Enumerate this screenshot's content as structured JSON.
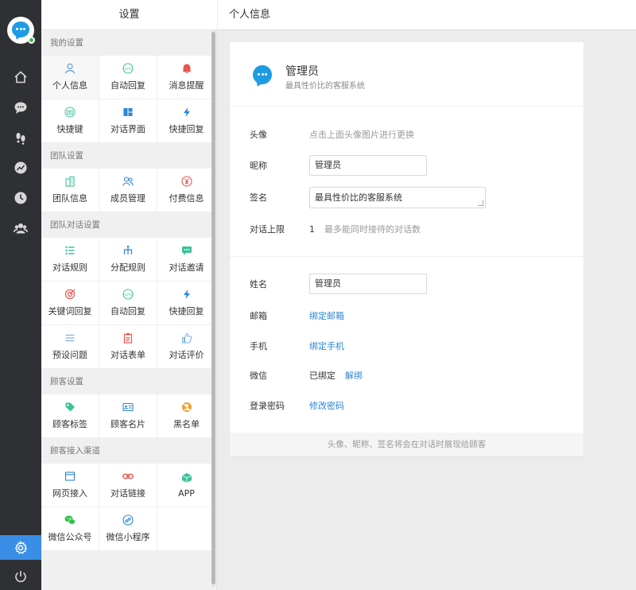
{
  "rail": {
    "icons": [
      "home-icon",
      "chat-icon",
      "footprint-icon",
      "chart-icon",
      "clock-icon",
      "team-icon",
      "settings-icon",
      "power-icon"
    ],
    "accent": "#3a8ee6",
    "bg": "#2f3033"
  },
  "settings": {
    "title": "设置",
    "groups": [
      {
        "title": "我的设置",
        "items": [
          {
            "label": "个人信息",
            "icon": "user-icon",
            "color": "#5b9bd5"
          },
          {
            "label": "自动回复",
            "icon": "auto-icon",
            "color": "#3cc29b"
          },
          {
            "label": "消息提醒",
            "icon": "bell-icon",
            "color": "#e8554e"
          },
          {
            "label": "快捷键",
            "icon": "keyboard-icon",
            "color": "#3cc29b"
          },
          {
            "label": "对话界面",
            "icon": "layout-icon",
            "color": "#2a86d9"
          },
          {
            "label": "快捷回复",
            "icon": "bolt-icon",
            "color": "#2a86d9"
          }
        ]
      },
      {
        "title": "团队设置",
        "items": [
          {
            "label": "团队信息",
            "icon": "building-icon",
            "color": "#3cc29b"
          },
          {
            "label": "成员管理",
            "icon": "members-icon",
            "color": "#2a86d9"
          },
          {
            "label": "付费信息",
            "icon": "yen-icon",
            "color": "#e8554e"
          }
        ]
      },
      {
        "title": "团队对话设置",
        "items": [
          {
            "label": "对话规则",
            "icon": "rules-icon",
            "color": "#3cc29b"
          },
          {
            "label": "分配规则",
            "icon": "branch-icon",
            "color": "#2a86d9"
          },
          {
            "label": "对话邀请",
            "icon": "invite-icon",
            "color": "#3cc29b"
          },
          {
            "label": "关键词回复",
            "icon": "target-icon",
            "color": "#e8554e"
          },
          {
            "label": "自动回复",
            "icon": "auto-icon",
            "color": "#3cc29b"
          },
          {
            "label": "快捷回复",
            "icon": "bolt-icon",
            "color": "#2a86d9"
          },
          {
            "label": "预设问题",
            "icon": "list-icon",
            "color": "#7fb3e0"
          },
          {
            "label": "对话表单",
            "icon": "clipboard-icon",
            "color": "#e8554e"
          },
          {
            "label": "对话评价",
            "icon": "thumbs-up-icon",
            "color": "#7fb3e0"
          }
        ]
      },
      {
        "title": "顾客设置",
        "items": [
          {
            "label": "顾客标签",
            "icon": "tag-icon",
            "color": "#3cc29b"
          },
          {
            "label": "顾客名片",
            "icon": "card-icon",
            "color": "#2a86d9"
          },
          {
            "label": "黑名单",
            "icon": "blacklist-icon",
            "color": "#f0a030"
          }
        ]
      },
      {
        "title": "顾客接入渠道",
        "items": [
          {
            "label": "网页接入",
            "icon": "browser-icon",
            "color": "#2a86d9"
          },
          {
            "label": "对话链接",
            "icon": "link-icon",
            "color": "#e8554e"
          },
          {
            "label": "APP",
            "icon": "cube-icon",
            "color": "#3cc29b"
          },
          {
            "label": "微信公众号",
            "icon": "wechat-icon",
            "color": "#2ec24a"
          },
          {
            "label": "微信小程序",
            "icon": "mini-program-icon",
            "color": "#2a86d9"
          }
        ]
      }
    ]
  },
  "topbar": {
    "title": "个人信息"
  },
  "profile": {
    "name": "管理员",
    "subtitle": "最具性价比的客服系统"
  },
  "form": {
    "avatar_label": "头像",
    "avatar_hint": "点击上面头像图片进行更换",
    "nickname_label": "昵称",
    "nickname_value": "管理员",
    "signature_label": "签名",
    "signature_value": "最具性价比的客服系统",
    "limit_label": "对话上限",
    "limit_value": "1",
    "limit_hint": "最多能同时接待的对话数",
    "realname_label": "姓名",
    "realname_value": "管理员",
    "email_label": "邮箱",
    "email_link": "绑定邮箱",
    "phone_label": "手机",
    "phone_link": "绑定手机",
    "wechat_label": "微信",
    "wechat_status": "已绑定",
    "wechat_unbind": "解绑",
    "password_label": "登录密码",
    "password_link": "修改密码"
  },
  "footer_note": "头像、昵称、签名将会在对话时展现给顾客"
}
